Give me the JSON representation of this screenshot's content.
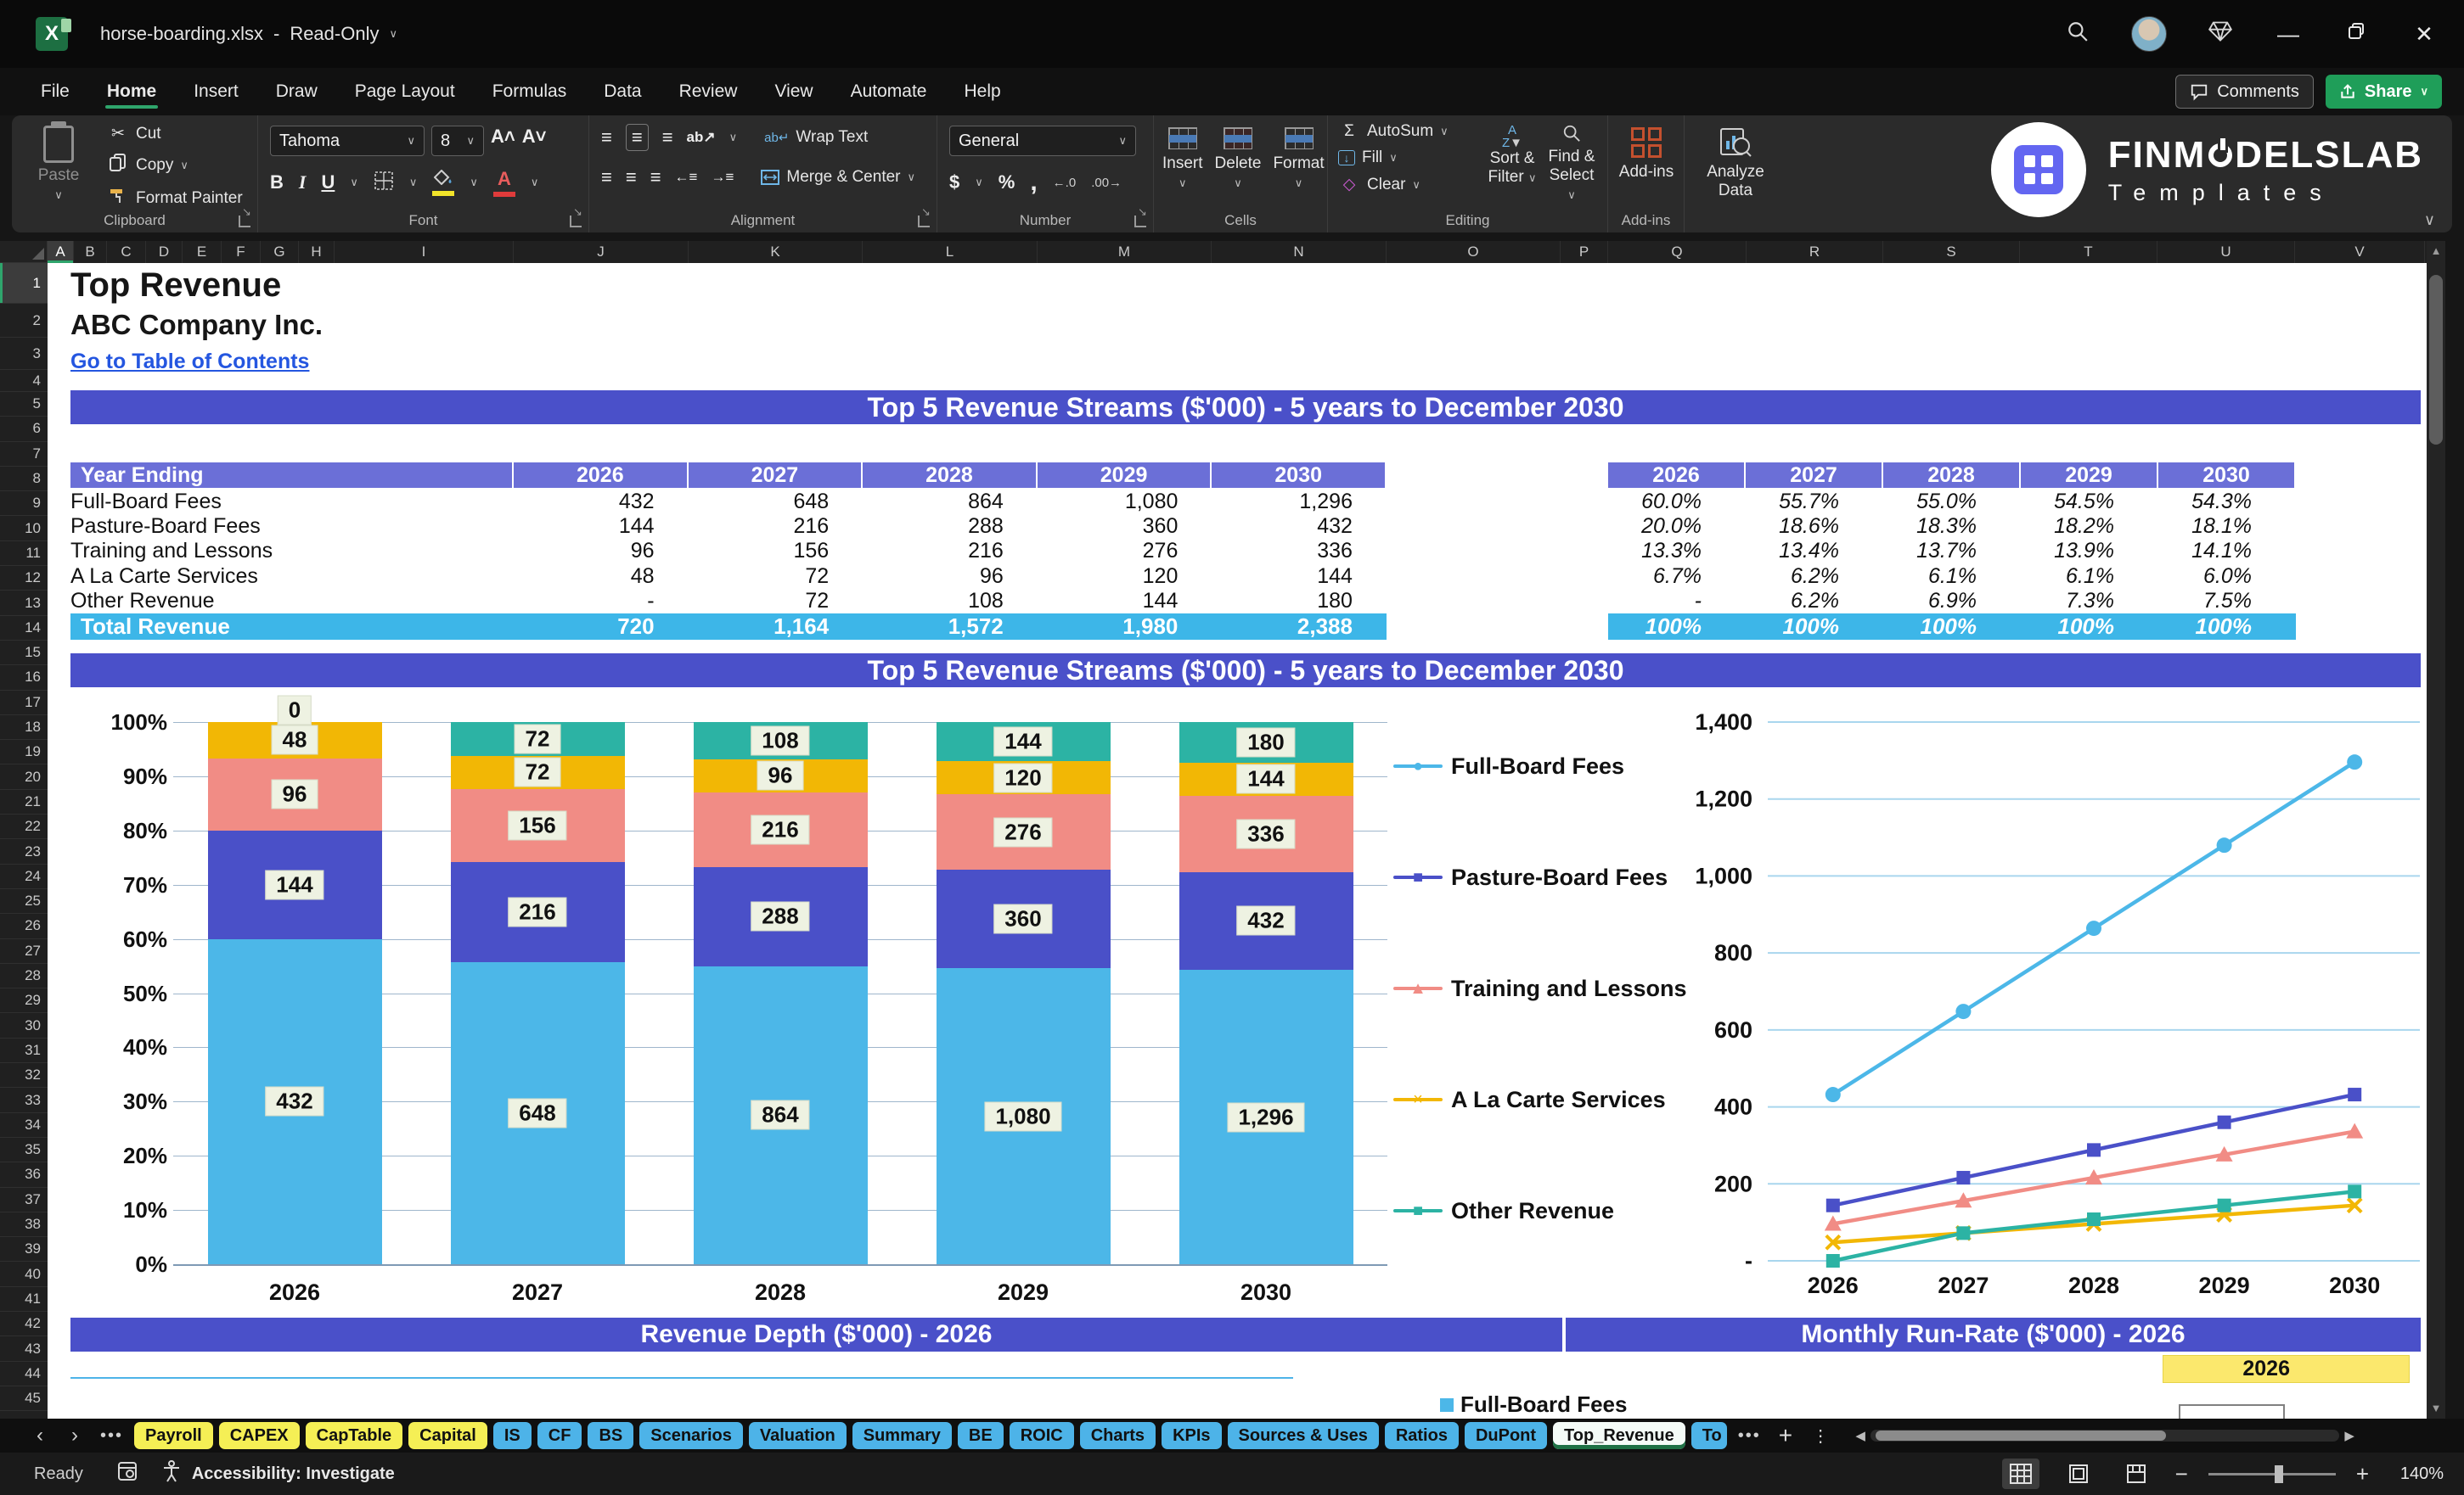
{
  "titlebar": {
    "filename": "horse-boarding.xlsx",
    "separator": "-",
    "mode": "Read-Only"
  },
  "ribbon_tabs": {
    "items": [
      "File",
      "Home",
      "Insert",
      "Draw",
      "Page Layout",
      "Formulas",
      "Data",
      "Review",
      "View",
      "Automate",
      "Help"
    ],
    "active": "Home"
  },
  "actions": {
    "comments": "Comments",
    "share": "Share"
  },
  "ribbon": {
    "clipboard": {
      "label": "Clipboard",
      "paste": "Paste",
      "cut": "Cut",
      "copy": "Copy",
      "format_painter": "Format Painter"
    },
    "font": {
      "label": "Font",
      "family": "Tahoma",
      "size": "8",
      "bold": "B",
      "italic": "I",
      "underline": "U",
      "font_color_glyph": "A"
    },
    "alignment": {
      "label": "Alignment",
      "wrap": "Wrap Text",
      "merge": "Merge & Center"
    },
    "number": {
      "label": "Number",
      "format": "General",
      "currency": "$",
      "percent": "%",
      "comma": ",",
      "inc_dec": "←.0",
      "dec_dec": ".00→"
    },
    "cells": {
      "label": "Cells",
      "insert": "Insert",
      "delete": "Delete",
      "format": "Format"
    },
    "editing": {
      "label": "Editing",
      "autosum": "AutoSum",
      "autosum_glyph": "Σ",
      "fill": "Fill",
      "clear": "Clear",
      "sort": "Sort & Filter",
      "find": "Find & Select"
    },
    "addins": {
      "label": "Add-ins",
      "addins": "Add-ins",
      "analyze": "Analyze Data"
    },
    "logo": {
      "part1": "FINM",
      "part2": "DELSLAB",
      "line2": "Templates"
    }
  },
  "grid": {
    "columns": [
      "A",
      "B",
      "C",
      "D",
      "E",
      "F",
      "G",
      "H",
      "I",
      "J",
      "K",
      "L",
      "M",
      "N",
      "O",
      "P",
      "Q",
      "R",
      "S",
      "T",
      "U",
      "V"
    ],
    "rows": [
      "1",
      "2",
      "3",
      "4",
      "5",
      "6",
      "7",
      "8",
      "9",
      "10",
      "11",
      "12",
      "13",
      "14",
      "15",
      "16",
      "17",
      "18",
      "19",
      "20",
      "21",
      "22",
      "23",
      "24",
      "25",
      "26",
      "27",
      "28",
      "29",
      "30",
      "31",
      "32",
      "33",
      "34",
      "35",
      "36",
      "37",
      "38",
      "39",
      "40",
      "41",
      "42",
      "43",
      "44",
      "45"
    ]
  },
  "sheet": {
    "title": "Top Revenue",
    "company": "ABC Company Inc.",
    "toc_link": "Go to Table of Contents",
    "banner_top": "Top 5 Revenue Streams ($'000) - 5 years to December 2030",
    "banner_chart": "Top 5 Revenue Streams ($'000) - 5 years to December 2030",
    "banner_depth": "Revenue Depth ($'000) - 2026",
    "banner_runrate": "Monthly Run-Rate ($'000) - 2026",
    "year_cell": "2026",
    "mini_legend": "Full-Board Fees",
    "table": {
      "header": "Year Ending",
      "years": [
        "2026",
        "2027",
        "2028",
        "2029",
        "2030"
      ],
      "rows": [
        {
          "label": "Full-Board Fees",
          "values": [
            "432",
            "648",
            "864",
            "1,080",
            "1,296"
          ]
        },
        {
          "label": "Pasture-Board Fees",
          "values": [
            "144",
            "216",
            "288",
            "360",
            "432"
          ]
        },
        {
          "label": "Training and Lessons",
          "values": [
            "96",
            "156",
            "216",
            "276",
            "336"
          ]
        },
        {
          "label": "A La Carte Services",
          "values": [
            "48",
            "72",
            "96",
            "120",
            "144"
          ]
        },
        {
          "label": "Other Revenue",
          "values": [
            "-",
            "72",
            "108",
            "144",
            "180"
          ]
        }
      ],
      "total": {
        "label": "Total Revenue",
        "values": [
          "720",
          "1,164",
          "1,572",
          "1,980",
          "2,388"
        ]
      }
    },
    "pct_table": {
      "years": [
        "2026",
        "2027",
        "2028",
        "2029",
        "2030"
      ],
      "rows": [
        [
          "60.0%",
          "55.7%",
          "55.0%",
          "54.5%",
          "54.3%"
        ],
        [
          "20.0%",
          "18.6%",
          "18.3%",
          "18.2%",
          "18.1%"
        ],
        [
          "13.3%",
          "13.4%",
          "13.7%",
          "13.9%",
          "14.1%"
        ],
        [
          "6.7%",
          "6.2%",
          "6.1%",
          "6.1%",
          "6.0%"
        ],
        [
          "-",
          "6.2%",
          "6.9%",
          "7.3%",
          "7.5%"
        ]
      ],
      "total": [
        "100%",
        "100%",
        "100%",
        "100%",
        "100%"
      ]
    }
  },
  "chart_data": [
    {
      "type": "bar",
      "stacking": "percent",
      "title": "Top 5 Revenue Streams ($'000) - 5 years to December 2030",
      "categories": [
        "2026",
        "2027",
        "2028",
        "2029",
        "2030"
      ],
      "series": [
        {
          "name": "Full-Board Fees",
          "color": "#4cb7e8",
          "values": [
            432,
            648,
            864,
            1080,
            1296
          ],
          "labels": [
            "432",
            "648",
            "864",
            "1,080",
            "1,296"
          ]
        },
        {
          "name": "Pasture-Board Fees",
          "color": "#4a50c8",
          "values": [
            144,
            216,
            288,
            360,
            432
          ],
          "labels": [
            "144",
            "216",
            "288",
            "360",
            "432"
          ]
        },
        {
          "name": "Training and Lessons",
          "color": "#f18c85",
          "values": [
            96,
            156,
            216,
            276,
            336
          ],
          "labels": [
            "96",
            "156",
            "216",
            "276",
            "336"
          ]
        },
        {
          "name": "A La Carte Services",
          "color": "#f2b705",
          "values": [
            48,
            72,
            96,
            120,
            144
          ],
          "labels": [
            "48",
            "72",
            "96",
            "120",
            "144"
          ]
        },
        {
          "name": "Other Revenue",
          "color": "#2cb3a4",
          "values": [
            0,
            72,
            108,
            144,
            180
          ],
          "labels": [
            "0",
            "72",
            "108",
            "144",
            "180"
          ]
        }
      ],
      "totals": [
        720,
        1164,
        1572,
        1980,
        2388
      ],
      "y_ticks": [
        "100%",
        "90%",
        "80%",
        "70%",
        "60%",
        "50%",
        "40%",
        "30%",
        "20%",
        "10%",
        "0%"
      ],
      "grid": true,
      "legend_position": "none"
    },
    {
      "type": "line",
      "categories": [
        "2026",
        "2027",
        "2028",
        "2029",
        "2030"
      ],
      "series": [
        {
          "name": "Full-Board Fees",
          "color": "#4cb7e8",
          "marker": "circle",
          "marker_glyph": "●",
          "values": [
            432,
            648,
            864,
            1080,
            1296
          ]
        },
        {
          "name": "Pasture-Board Fees",
          "color": "#4a50c8",
          "marker": "square",
          "marker_glyph": "■",
          "values": [
            144,
            216,
            288,
            360,
            432
          ]
        },
        {
          "name": "Training and Lessons",
          "color": "#f18c85",
          "marker": "triangle",
          "marker_glyph": "▲",
          "values": [
            96,
            156,
            216,
            276,
            336
          ]
        },
        {
          "name": "A La Carte Services",
          "color": "#f2b705",
          "marker": "x",
          "marker_glyph": "×",
          "values": [
            48,
            72,
            96,
            120,
            144
          ]
        },
        {
          "name": "Other Revenue",
          "color": "#2cb3a4",
          "marker": "square",
          "marker_glyph": "■",
          "values": [
            0,
            72,
            108,
            144,
            180
          ]
        }
      ],
      "ylim": [
        0,
        1400
      ],
      "ytick_step": 200,
      "y_tick_labels": [
        "-",
        "200",
        "400",
        "600",
        "800",
        "1,000",
        "1,200",
        "1,400"
      ],
      "grid": true,
      "legend_position": "left"
    }
  ],
  "sheet_tabs": {
    "tabs": [
      {
        "label": "Payroll",
        "color": "yellow"
      },
      {
        "label": "CAPEX",
        "color": "yellow"
      },
      {
        "label": "CapTable",
        "color": "yellow"
      },
      {
        "label": "Capital",
        "color": "yellow"
      },
      {
        "label": "IS",
        "color": "blue"
      },
      {
        "label": "CF",
        "color": "blue"
      },
      {
        "label": "BS",
        "color": "blue"
      },
      {
        "label": "Scenarios",
        "color": "blue"
      },
      {
        "label": "Valuation",
        "color": "blue"
      },
      {
        "label": "Summary",
        "color": "blue"
      },
      {
        "label": "BE",
        "color": "blue"
      },
      {
        "label": "ROIC",
        "color": "blue"
      },
      {
        "label": "Charts",
        "color": "blue"
      },
      {
        "label": "KPIs",
        "color": "blue"
      },
      {
        "label": "Sources & Uses",
        "color": "blue"
      },
      {
        "label": "Ratios",
        "color": "blue"
      },
      {
        "label": "DuPont",
        "color": "blue"
      },
      {
        "label": "Top_Revenue",
        "color": "active"
      },
      {
        "label": "To",
        "color": "blue",
        "partial": true
      }
    ]
  },
  "statusbar": {
    "ready": "Ready",
    "accessibility": "Accessibility: Investigate",
    "zoom_level": "140%"
  },
  "colors": {
    "banner": "#4a50c9",
    "table_header": "#6b6fd7",
    "total_row": "#3db6e8",
    "excel_green": "#1d6f42",
    "share_green": "#1f9e59"
  }
}
